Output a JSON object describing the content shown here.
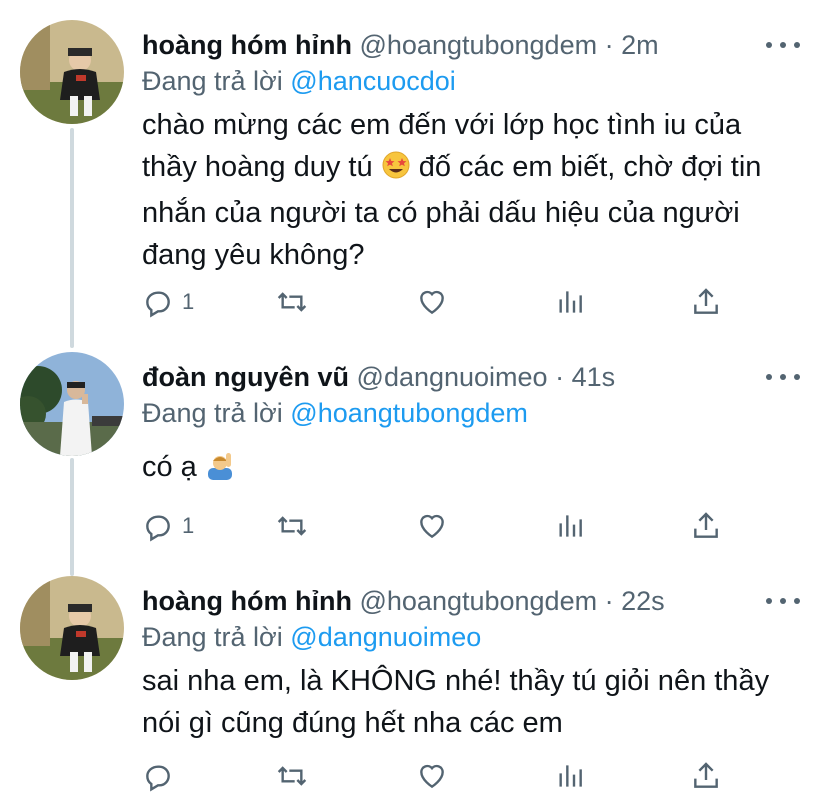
{
  "tweets": [
    {
      "name": "hoàng hóm hỉnh",
      "handle": "@hoangtubongdem",
      "dot": "·",
      "time": "2m",
      "reply_prefix": "Đang trả lời",
      "reply_to": "@hancuocdoi",
      "text_1": "chào mừng các em đến với lớp học tình iu của thầy hoàng duy tú",
      "emoji_1": "star-struck-emoji",
      "text_2": "đố các em biết, chờ đợi tin nhắn của người ta có phải dấu hiệu của người đang yêu không?",
      "reply_count": "1"
    },
    {
      "name": "đoàn nguyên vũ",
      "handle": "@dangnuoimeo",
      "dot": "·",
      "time": "41s",
      "reply_prefix": "Đang trả lời",
      "reply_to": "@hoangtubongdem",
      "text_1": "có ạ",
      "emoji_1": "person-raising-hand-emoji",
      "reply_count": "1"
    },
    {
      "name": "hoàng hóm hỉnh",
      "handle": "@hoangtubongdem",
      "dot": "·",
      "time": "22s",
      "reply_prefix": "Đang trả lời",
      "reply_to": "@dangnuoimeo",
      "text_1": "sai nha em, là KHÔNG nhé! thầy tú giỏi nên thầy nói gì cũng đúng hết nha các em",
      "reply_count": ""
    }
  ],
  "colors": {
    "text": "#0f1419",
    "secondary": "#536471",
    "link": "#1d9bf0",
    "thread_line": "#cfd9de"
  }
}
